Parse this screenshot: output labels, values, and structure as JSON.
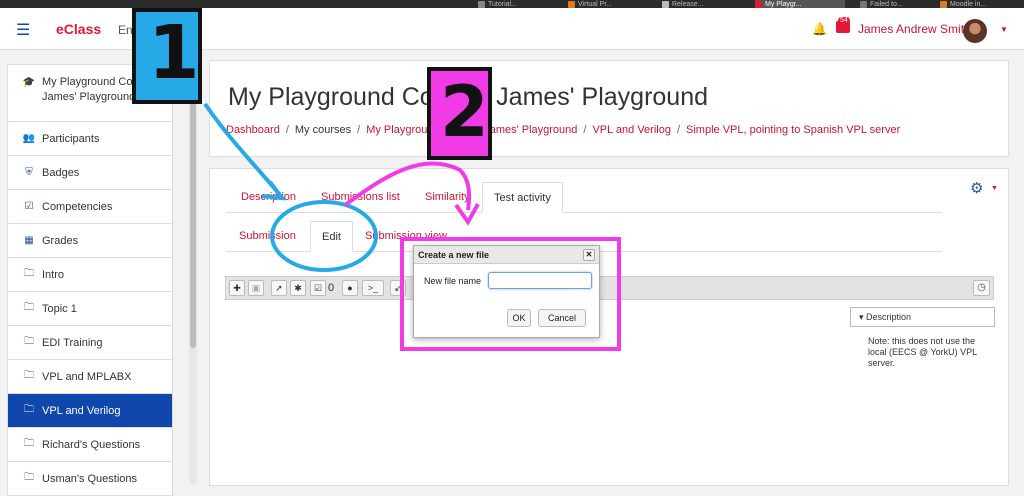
{
  "browser": {
    "tabs": [
      {
        "label": "Tutorial...",
        "color": "#888888"
      },
      {
        "label": "Virtual Pr...",
        "color": "#e07a1f"
      },
      {
        "label": "Release...",
        "color": "#bbbbbb"
      },
      {
        "label": "My Playgr...",
        "color": "#e31837"
      },
      {
        "label": "Failed to...",
        "color": "#777777"
      },
      {
        "label": "Moodle in...",
        "color": "#e07a1f"
      }
    ]
  },
  "navbar": {
    "brand": "eClass",
    "language": "Eng",
    "message_count": "54",
    "user_name": "James Andrew Smith",
    "brand_color": "#e31837"
  },
  "sidebar": {
    "course": "My Playground Course: James' Playground",
    "items": [
      {
        "label": "Participants",
        "icon": "users-icon"
      },
      {
        "label": "Badges",
        "icon": "shield-icon"
      },
      {
        "label": "Competencies",
        "icon": "checkbox-icon"
      },
      {
        "label": "Grades",
        "icon": "table-icon"
      },
      {
        "label": "Intro",
        "icon": "folder-icon"
      },
      {
        "label": "Topic 1",
        "icon": "folder-icon"
      },
      {
        "label": "EDI Training",
        "icon": "folder-icon"
      },
      {
        "label": "VPL and MPLABX",
        "icon": "folder-icon"
      },
      {
        "label": "VPL and Verilog",
        "icon": "folder-icon",
        "active": true
      },
      {
        "label": "Richard's Questions",
        "icon": "folder-icon"
      },
      {
        "label": "Usman's Questions",
        "icon": "folder-icon"
      }
    ]
  },
  "header": {
    "title": "My Playground Course: James' Playground",
    "breadcrumb": [
      {
        "label": "Dashboard",
        "link": true
      },
      {
        "label": "My courses",
        "link": false
      },
      {
        "label": "My Playground Course: James' Playground",
        "link": true
      },
      {
        "label": "VPL and Verilog",
        "link": true
      },
      {
        "label": "Simple VPL, pointing to Spanish VPL server",
        "link": true
      }
    ]
  },
  "tabs_primary": [
    "Description",
    "Submissions list",
    "Similarity",
    "Test activity"
  ],
  "tabs_secondary": [
    "Submission",
    "Edit",
    "Submission view"
  ],
  "toolbar": {
    "check_count": "0",
    "console_glyph": ">_"
  },
  "description": {
    "toggle": "Description",
    "note": "Note: this does not use the local (EECS @ YorkU) VPL server."
  },
  "dialog": {
    "title": "Create a new file",
    "field_label": "New file name",
    "field_value": "",
    "ok": "OK",
    "cancel": "Cancel"
  },
  "annotations": {
    "label_1": "1",
    "label_2": "2",
    "blue": "#27a9e8",
    "magenta": "#f03be6"
  }
}
